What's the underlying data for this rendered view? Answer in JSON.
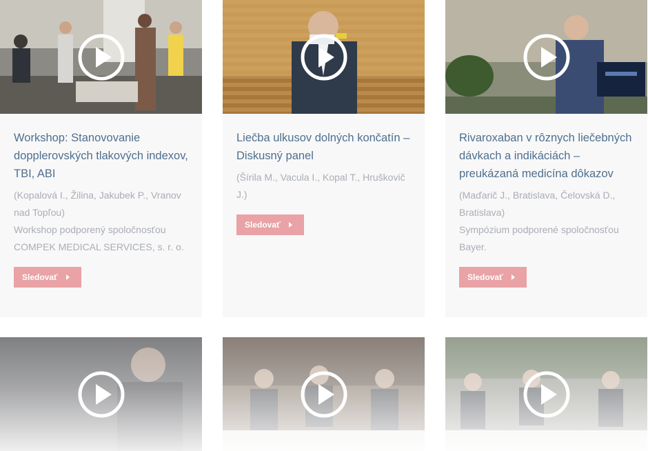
{
  "icons": {
    "play": "play-circle-icon",
    "button_arrow": "caret-right-icon"
  },
  "colors": {
    "title": "#4e6f8e",
    "meta": "#a9adb3",
    "button_bg": "#e9a2a5",
    "card_bg": "#f8f8f9"
  },
  "cards": [
    {
      "title": "Workshop: Stanovovanie dopplerovských tlakových indexov, TBI, ABI",
      "authors": "(Kopalová I., Žilina, Jakubek P., Vranov nad Topľou)",
      "note": "Workshop podporený spoločnosťou COMPEK MEDICAL SERVICES, s. r. o.",
      "button": "Sledovať"
    },
    {
      "title": "Liečba ulkusov dolných končatín – Diskusný panel",
      "authors": "(Šírila M., Vacula I., Kopal T., Hruškovič J.)",
      "note": "",
      "button": "Sledovať"
    },
    {
      "title": "Rivaroxaban v rôznych liečebných dávkach a indikáciách – preukázaná medicína dôkazov",
      "authors": "(Maďarič J., Bratislava, Čelovská D., Bratislava)",
      "note": "Sympózium podporené spoločnosťou Bayer.",
      "button": "Sledovať"
    }
  ]
}
